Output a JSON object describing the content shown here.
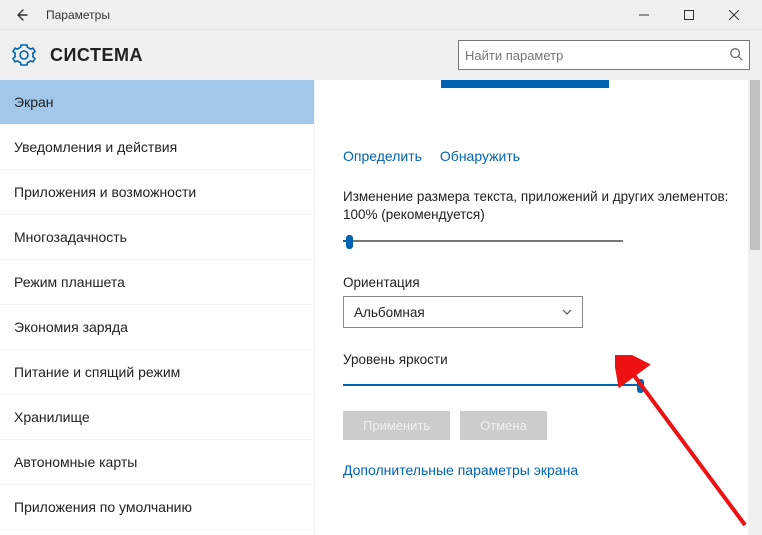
{
  "window": {
    "title": "Параметры"
  },
  "header": {
    "title": "СИСТЕМА",
    "search_placeholder": "Найти параметр"
  },
  "sidebar": {
    "items": [
      "Экран",
      "Уведомления и действия",
      "Приложения и возможности",
      "Многозадачность",
      "Режим планшета",
      "Экономия заряда",
      "Питание и спящий режим",
      "Хранилище",
      "Автономные карты",
      "Приложения по умолчанию"
    ],
    "selected_index": 0
  },
  "content": {
    "links": {
      "identify": "Определить",
      "detect": "Обнаружить"
    },
    "scale_label": "Изменение размера текста, приложений и других элементов: 100% (рекомендуется)",
    "scale_value_pct": 2,
    "orientation_label": "Ориентация",
    "orientation_value": "Альбомная",
    "brightness_label": "Уровень яркости",
    "brightness_value_pct": 99,
    "apply_btn": "Применить",
    "cancel_btn": "Отмена",
    "advanced_link": "Дополнительные параметры экрана"
  }
}
